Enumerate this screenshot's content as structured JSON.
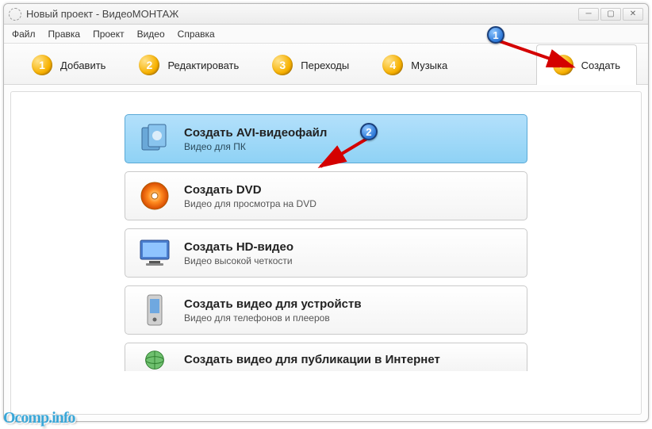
{
  "window": {
    "title": "Новый проект - ВидеоМОНТАЖ"
  },
  "menu": {
    "file": "Файл",
    "edit": "Правка",
    "project": "Проект",
    "video": "Видео",
    "help": "Справка"
  },
  "tabs": {
    "add": {
      "num": "1",
      "label": "Добавить"
    },
    "edit": {
      "num": "2",
      "label": "Редактировать"
    },
    "trans": {
      "num": "3",
      "label": "Переходы"
    },
    "music": {
      "num": "4",
      "label": "Музыка"
    },
    "create": {
      "label": "Создать"
    }
  },
  "options": {
    "avi": {
      "title": "Создать AVI-видеофайл",
      "subtitle": "Видео для ПК"
    },
    "dvd": {
      "title": "Создать DVD",
      "subtitle": "Видео для просмотра на DVD"
    },
    "hd": {
      "title": "Создать HD-видео",
      "subtitle": "Видео высокой четкости"
    },
    "device": {
      "title": "Создать видео для устройств",
      "subtitle": "Видео для телефонов и плееров"
    },
    "web": {
      "title": "Создать видео для публикации в Интернет"
    }
  },
  "callouts": {
    "one": "1",
    "two": "2"
  },
  "watermark": "Ocomp.info"
}
